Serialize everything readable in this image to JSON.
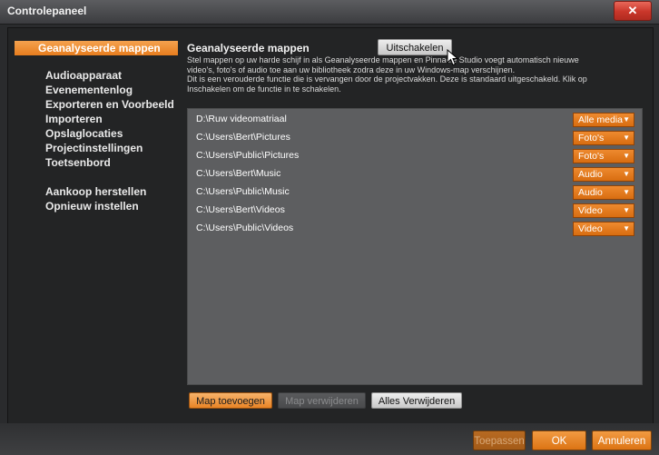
{
  "window": {
    "title": "Controlepaneel",
    "close_label": "✕"
  },
  "sidebar": {
    "items": [
      {
        "label": "Geanalyseerde mappen",
        "active": true
      },
      {
        "label": "Audioapparaat"
      },
      {
        "label": "Evenementenlog"
      },
      {
        "label": "Exporteren en Voorbeeld"
      },
      {
        "label": "Importeren"
      },
      {
        "label": "Opslaglocaties"
      },
      {
        "label": "Projectinstellingen"
      },
      {
        "label": "Toetsenbord"
      },
      {
        "label": "Aankoop herstellen"
      },
      {
        "label": "Opnieuw instellen"
      }
    ]
  },
  "main": {
    "title": "Geanalyseerde mappen",
    "toggle_button": "Uitschakelen",
    "description_line1": "Stel mappen op uw harde schijf in als Geanalyseerde mappen en Pinnacle Studio voegt automatisch nieuwe",
    "description_line2": "video's, foto's of audio toe aan uw bibliotheek zodra deze in uw Windows-map verschijnen.",
    "description_line3": "Dit is een verouderde functie die is vervangen door de projectvakken. Deze is standaard uitgeschakeld. Klik op",
    "description_line4": "Inschakelen om de functie in te schakelen.",
    "folders": [
      {
        "path": "D:\\Ruw videomatriaal",
        "media": "Alle media"
      },
      {
        "path": "C:\\Users\\Bert\\Pictures",
        "media": "Foto's"
      },
      {
        "path": "C:\\Users\\Public\\Pictures",
        "media": "Foto's"
      },
      {
        "path": "C:\\Users\\Bert\\Music",
        "media": "Audio"
      },
      {
        "path": "C:\\Users\\Public\\Music",
        "media": "Audio"
      },
      {
        "path": "C:\\Users\\Bert\\Videos",
        "media": "Video"
      },
      {
        "path": "C:\\Users\\Public\\Videos",
        "media": "Video"
      }
    ],
    "add_folder": "Map toevoegen",
    "remove_folder": "Map verwijderen",
    "remove_all": "Alles Verwijderen"
  },
  "footer": {
    "apply": "Toepassen",
    "ok": "OK",
    "cancel": "Annuleren"
  },
  "colors": {
    "accent": "#e77d1e",
    "panel": "#5d5e60",
    "close": "#c9362a"
  }
}
